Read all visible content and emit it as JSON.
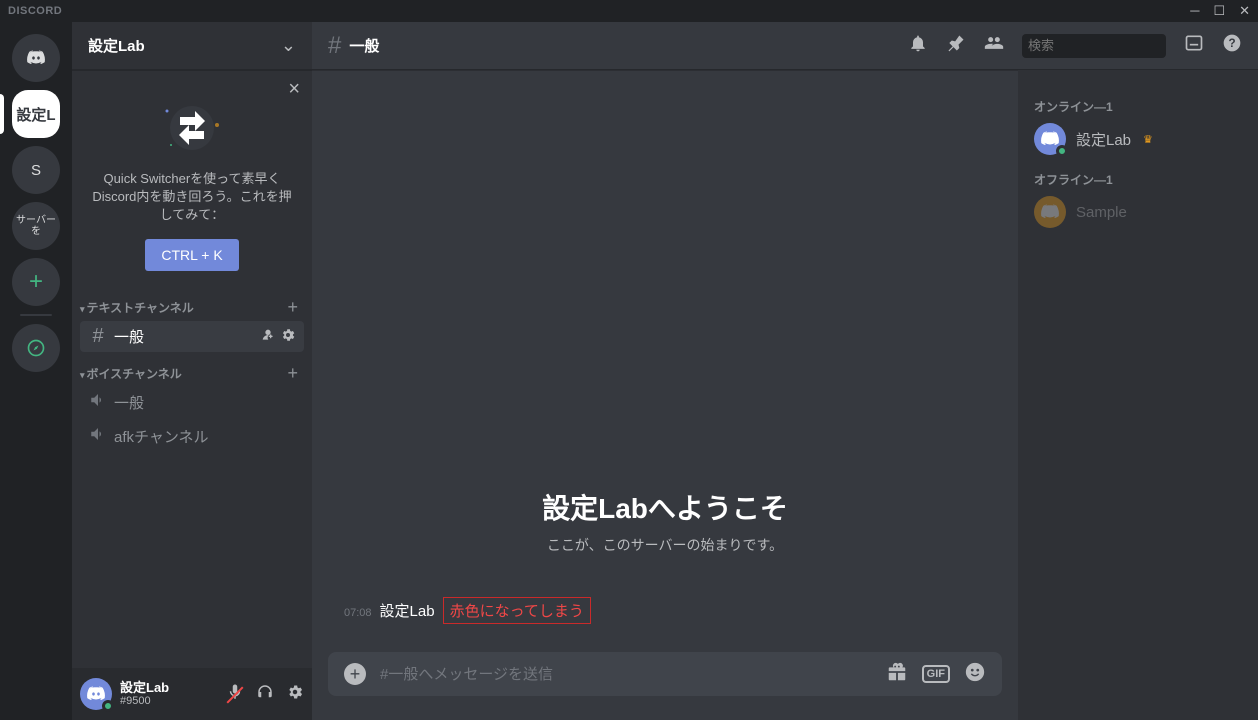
{
  "titlebar": {
    "app_name": "DISCORD"
  },
  "servers": {
    "selected_label": "設定L",
    "s_label": "S",
    "add_server_label": "サーバーを",
    "explore_label": ""
  },
  "server_header": {
    "name": "設定Lab"
  },
  "promo": {
    "text": "Quick Switcherを使って素早くDiscord内を動き回ろう。これを押してみて：",
    "button": "CTRL + K"
  },
  "categories": {
    "text": {
      "label": "テキストチャンネル"
    },
    "voice": {
      "label": "ボイスチャンネル"
    }
  },
  "text_channels": {
    "general": "一般"
  },
  "voice_channels": {
    "general": "一般",
    "afk": "afkチャンネル"
  },
  "user_panel": {
    "name": "設定Lab",
    "tag": "#9500"
  },
  "chat": {
    "channel_name": "一般",
    "search_placeholder": "検索",
    "welcome_title": "設定Labへようこそ",
    "welcome_sub": "ここが、このサーバーの始まりです。",
    "message": {
      "time": "07:08",
      "author": "設定Lab",
      "text": "赤色になってしまう"
    },
    "composer_placeholder": "#一般へメッセージを送信",
    "gif_label": "GIF"
  },
  "members": {
    "online_header": "オンライン—1",
    "offline_header": "オフライン—1",
    "user1": "設定Lab",
    "user2": "Sample"
  }
}
